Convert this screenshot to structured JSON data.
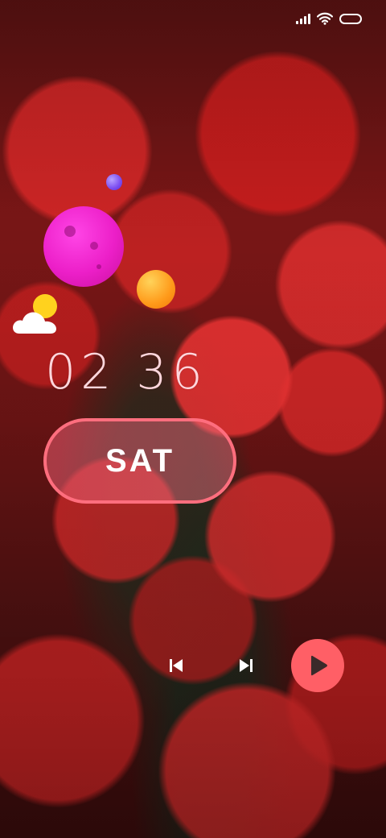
{
  "status_bar": {
    "signal_icon": "signal-icon",
    "wifi_icon": "wifi-icon",
    "battery_icon": "battery-icon"
  },
  "weather": {
    "icon": "partly-sunny-icon"
  },
  "clock": {
    "time": "02 36",
    "day": "SAT"
  },
  "media": {
    "previous_icon": "skip-previous-icon",
    "next_icon": "skip-next-icon",
    "play_icon": "play-icon"
  },
  "colors": {
    "accent_pink": "#ff6e7e",
    "play_button": "#ff5f66",
    "planet_magenta": "#ec1fc8",
    "planet_orange": "#ff9a1a",
    "planet_violet": "#7b4cf0"
  }
}
